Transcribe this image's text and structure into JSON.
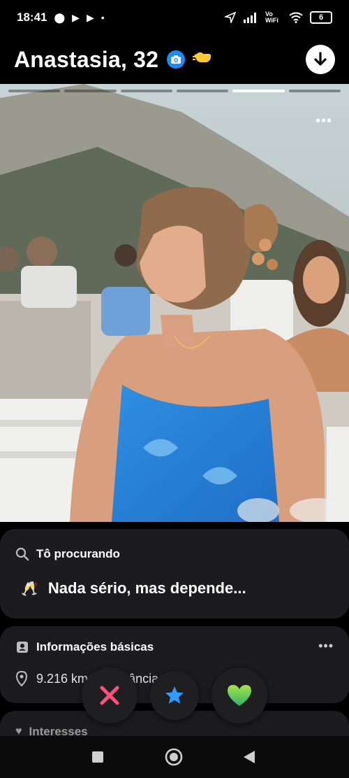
{
  "status_bar": {
    "time": "18:41",
    "battery": "6",
    "network": "Vo WiFi"
  },
  "profile": {
    "name_age": "Anastasia, 32"
  },
  "photos": {
    "count": 6,
    "active_index": 4
  },
  "looking_for": {
    "title": "Tô procurando",
    "value": "Nada sério, mas depende...",
    "emoji": "🥂"
  },
  "basics": {
    "title": "Informações básicas",
    "distance": "9.216 km de distância"
  },
  "interests": {
    "title": "Interesses"
  },
  "colors": {
    "accent_blue": "#1a8cff",
    "nope": "#ff4f7b",
    "superlike": "#2f9bff",
    "like": "#66d23a"
  }
}
